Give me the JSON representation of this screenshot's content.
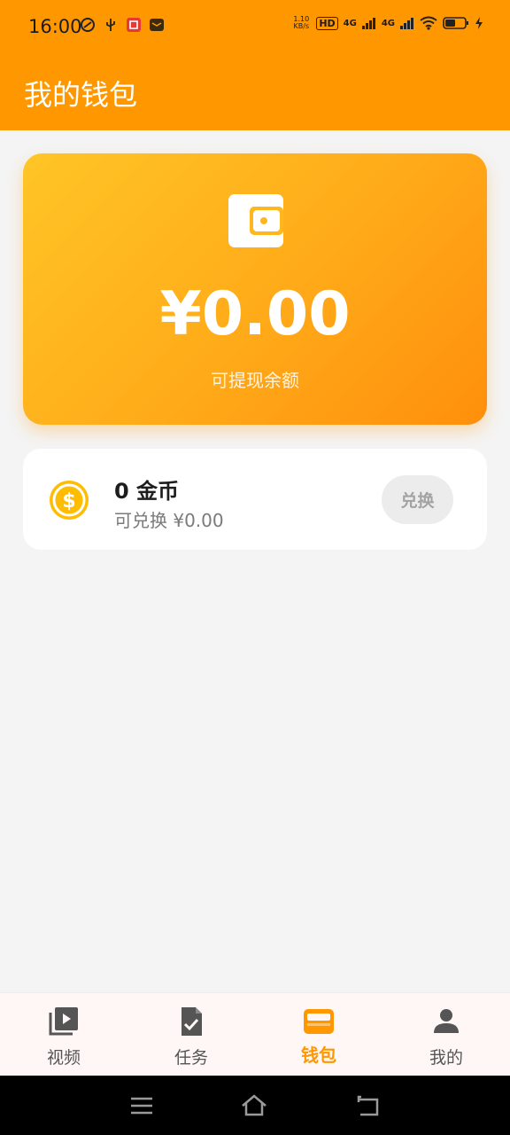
{
  "status_bar": {
    "time": "16:00",
    "net_speed": "1.10",
    "net_unit": "KB/s",
    "hd_badge": "HD",
    "signal1_type": "4G",
    "signal2_type": "4G"
  },
  "header": {
    "title": "我的钱包"
  },
  "balance_card": {
    "amount": "¥0.00",
    "label": "可提现余额",
    "icon": "wallet-icon"
  },
  "coins": {
    "count": "0 金币",
    "exchange_value": "可兑换 ¥0.00",
    "exchange_button": "兑换",
    "icon": "dollar-coin-icon"
  },
  "bottom_nav": {
    "items": [
      {
        "label": "视频",
        "icon": "video-library-icon",
        "active": false
      },
      {
        "label": "任务",
        "icon": "task-check-icon",
        "active": false
      },
      {
        "label": "钱包",
        "icon": "wallet-icon",
        "active": true
      },
      {
        "label": "我的",
        "icon": "person-icon",
        "active": false
      }
    ]
  },
  "colors": {
    "primary": "#ff9800",
    "card_gradient_start": "#ffc526",
    "card_gradient_end": "#ff8f0c",
    "coin": "#ffbc00",
    "inactive": "#555555",
    "background": "#f4f4f4"
  }
}
